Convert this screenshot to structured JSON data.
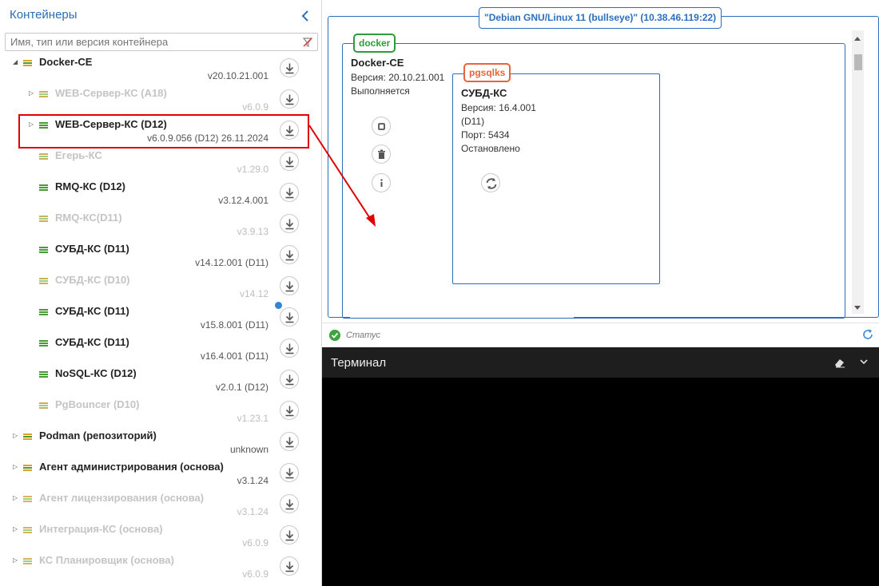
{
  "sidebar": {
    "title": "Контейнеры",
    "search_placeholder": "Имя, тип или версия контейнера"
  },
  "tree": [
    {
      "name": "Docker-CE",
      "version": "v20.10.21.001",
      "dim": false,
      "expanded": true
    },
    {
      "name": "WEB-Сервер-КС (А18)",
      "version": "v6.0.9",
      "dim": true
    },
    {
      "name": "WEB-Сервер-КС (D12)",
      "version": "v6.0.9.056 (D12) 26.11.2024",
      "dim": false,
      "highlighted": true
    },
    {
      "name": "Егерь-КС",
      "version": "v1.29.0",
      "dim": true
    },
    {
      "name": "RMQ-КС (D12)",
      "version": "v3.12.4.001",
      "dim": false
    },
    {
      "name": "RMQ-КС(D11)",
      "version": "v3.9.13",
      "dim": true
    },
    {
      "name": "СУБД-КС (D11)",
      "version": "v14.12.001 (D11)",
      "dim": false
    },
    {
      "name": "СУБД-КС (D10)",
      "version": "v14.12",
      "dim": true
    },
    {
      "name": "СУБД-КС (D11)",
      "version": "v15.8.001 (D11)",
      "dim": false,
      "info": true
    },
    {
      "name": "СУБД-КС (D11)",
      "version": "v16.4.001 (D11)",
      "dim": false
    },
    {
      "name": "NoSQL-КС (D12)",
      "version": "v2.0.1 (D12)",
      "dim": false
    },
    {
      "name": "PgBouncer (D10)",
      "version": "v1.23.1",
      "dim": true
    },
    {
      "name": "Podman (репозиторий)",
      "version": "unknown",
      "dim": false
    },
    {
      "name": "Агент администрирования (основа)",
      "version": "v3.1.24",
      "dim": false
    },
    {
      "name": "Агент лицензирования (основа)",
      "version": "v3.1.24",
      "dim": true
    },
    {
      "name": "Интеграция-КС (основа)",
      "version": "v6.0.9",
      "dim": true
    },
    {
      "name": "КС Планировщик (основа)",
      "version": "v6.0.9",
      "dim": true
    }
  ],
  "host": {
    "label": "\"Debian GNU/Linux 11 (bullseye)\" (10.38.46.119:22)"
  },
  "docker": {
    "tag": "docker",
    "title": "Docker-CE",
    "version": "Версия: 20.10.21.001",
    "state": "Выполняется"
  },
  "pg": {
    "tag": "pgsqlks",
    "title": "СУБД-КС",
    "version": "Версия: 16.4.001",
    "dist": "(D11)",
    "port": "Порт: 5434",
    "state": "Остановлено"
  },
  "status": {
    "text": "Статус"
  },
  "terminal": {
    "title": "Терминал"
  },
  "colors": {
    "accent": "#2c6fbf",
    "docker": "#2e9c3c",
    "pg": "#e9643a",
    "highlight": "#e00000"
  }
}
